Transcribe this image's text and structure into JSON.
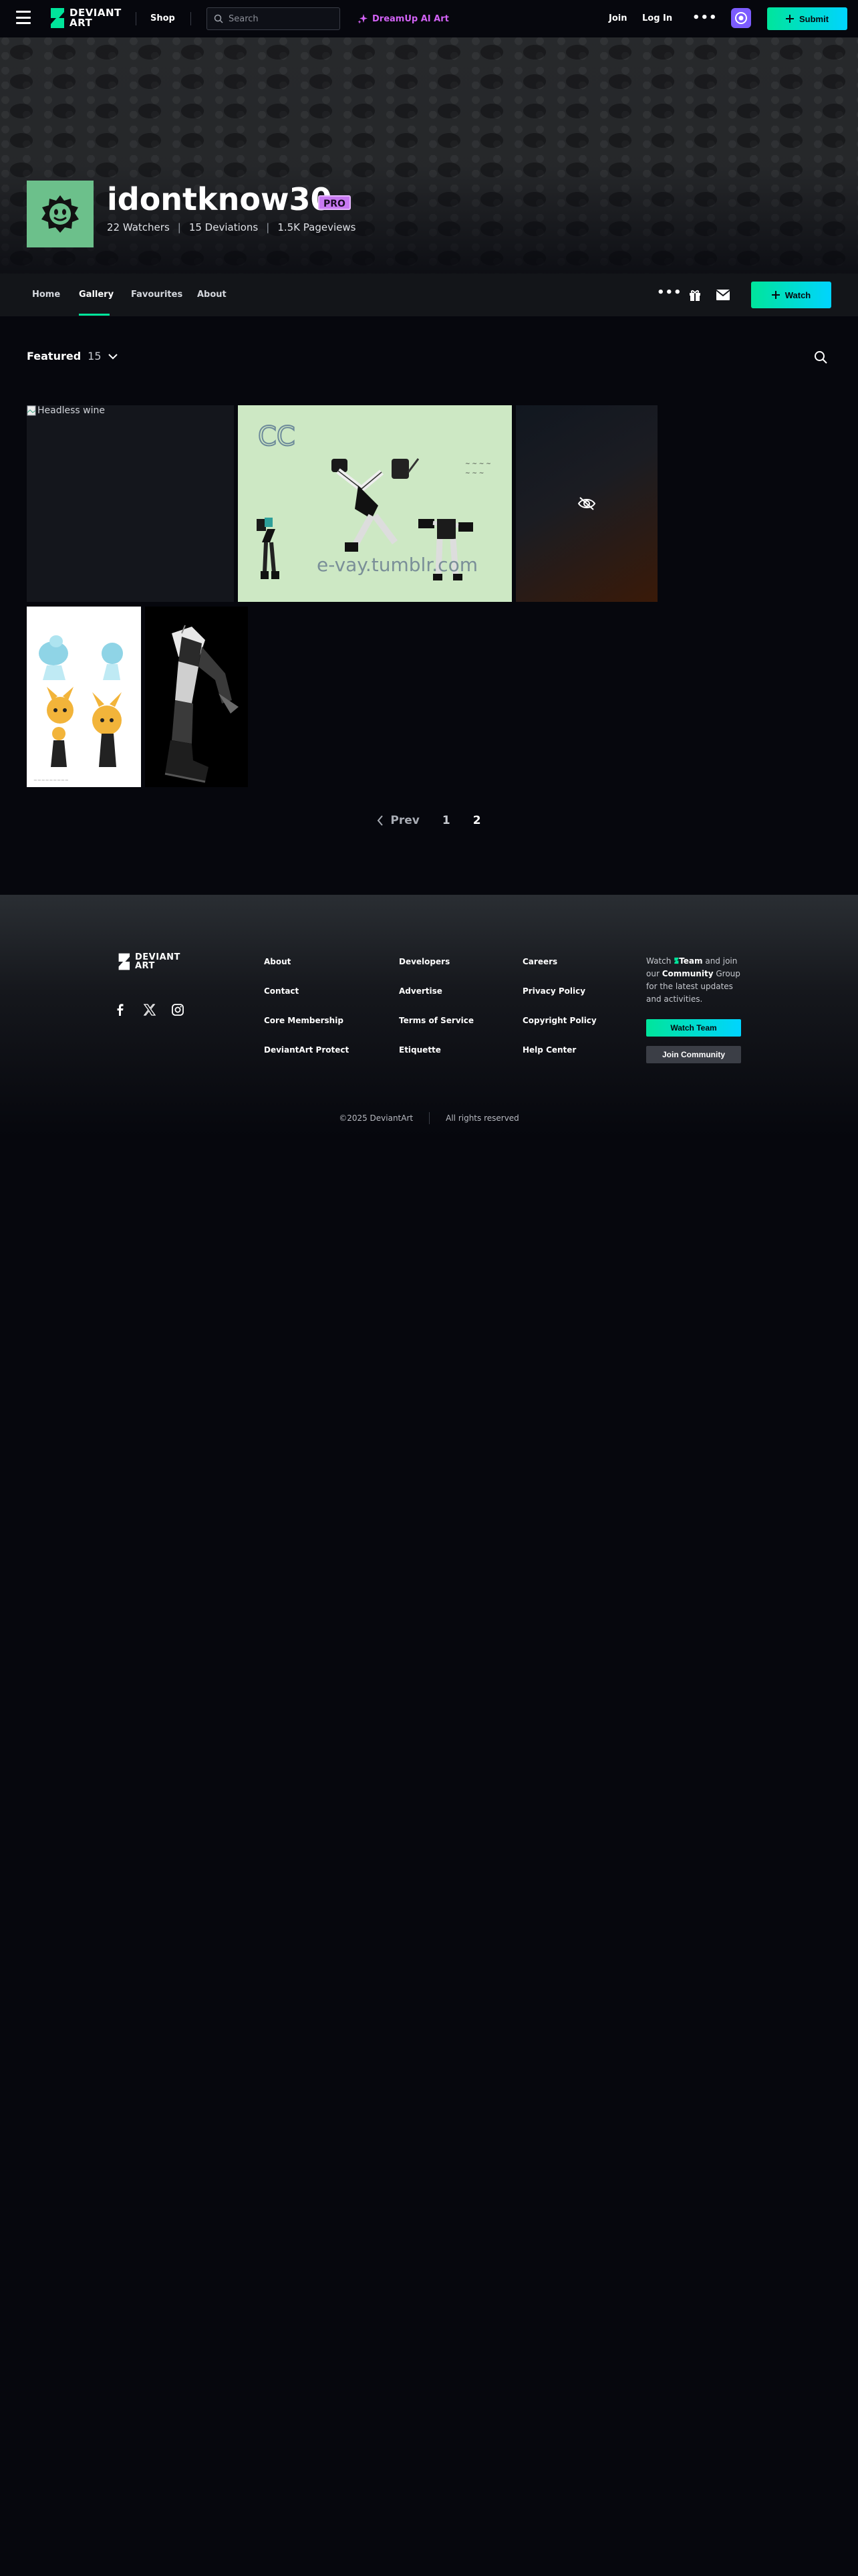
{
  "topbar": {
    "logo_line1": "DEVIANT",
    "logo_line2": "ART",
    "shop": "Shop",
    "search_placeholder": "Search",
    "dreamup": "DreamUp AI Art",
    "join": "Join",
    "login": "Log In",
    "more": "•••",
    "submit": "Submit"
  },
  "profile": {
    "username": "idontknow30",
    "badge": "PRO",
    "watchers": "22 Watchers",
    "deviations": "15 Deviations",
    "pageviews": "1.5K Pageviews",
    "sep": "|"
  },
  "profile_nav": {
    "tabs": [
      {
        "label": "Home"
      },
      {
        "label": "Gallery"
      },
      {
        "label": "Favourites"
      },
      {
        "label": "About"
      }
    ],
    "more": "•••",
    "watch": "Watch"
  },
  "gallery": {
    "folder": "Featured",
    "count": "15",
    "items": [
      {
        "alt": "Headless wine"
      },
      {
        "caption_cc": "CC",
        "caption_url": "e-vay.tumblr.com"
      }
    ]
  },
  "pagination": {
    "prev": "Prev",
    "pages": [
      "1",
      "2"
    ]
  },
  "footer": {
    "col1": [
      "About",
      "Contact",
      "Core Membership",
      "DeviantArt Protect"
    ],
    "col2": [
      "Developers",
      "Advertise",
      "Terms of Service",
      "Etiquette"
    ],
    "col3": [
      "Careers",
      "Privacy Policy",
      "Copyright Policy",
      "Help Center"
    ],
    "watch_text_1": "Watch ",
    "watch_text_team": "Team",
    "watch_text_2": " and join our ",
    "watch_text_comm": "Community",
    "watch_text_3": " Group for the latest updates and activities.",
    "watch_team_btn": "Watch Team",
    "join_comm_btn": "Join Community",
    "copyright": "©2025 DeviantArt",
    "rights": "All rights reserved"
  },
  "colors": {
    "accent": "#00e59b",
    "accent2": "#00d4ff",
    "dreamup": "#d262f5",
    "pro": "#c879f2",
    "bg": "#06070d"
  }
}
